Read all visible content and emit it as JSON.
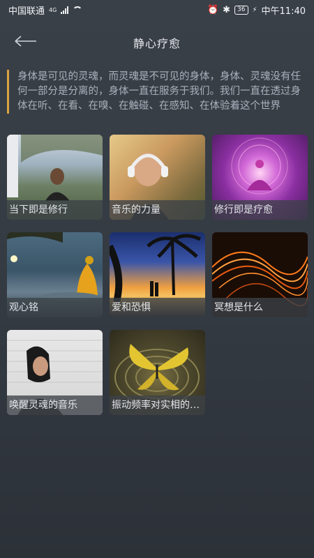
{
  "status_bar": {
    "carrier": "中国联通",
    "network": "4G",
    "battery": "36",
    "time": "中午11:40"
  },
  "header": {
    "title": "静心疗愈",
    "back_icon": "back-arrow-icon"
  },
  "quote": {
    "text": "身体是可见的灵魂，而灵魂是不可见的身体，身体、灵魂没有任何一部分是分离的，身体一直在服务于我们。我们一直在透过身体在听、在看、在嗅、在触碰、在感知、在体验着这个世界",
    "accent_color": "#d9a441"
  },
  "cards": [
    {
      "label": "当下即是修行"
    },
    {
      "label": "音乐的力量"
    },
    {
      "label": "修行即是疗愈"
    },
    {
      "label": "观心铭"
    },
    {
      "label": "爱和恐惧"
    },
    {
      "label": "冥想是什么"
    },
    {
      "label": "唤醒灵魂的音乐"
    },
    {
      "label": "振动频率对实相的影响"
    }
  ]
}
